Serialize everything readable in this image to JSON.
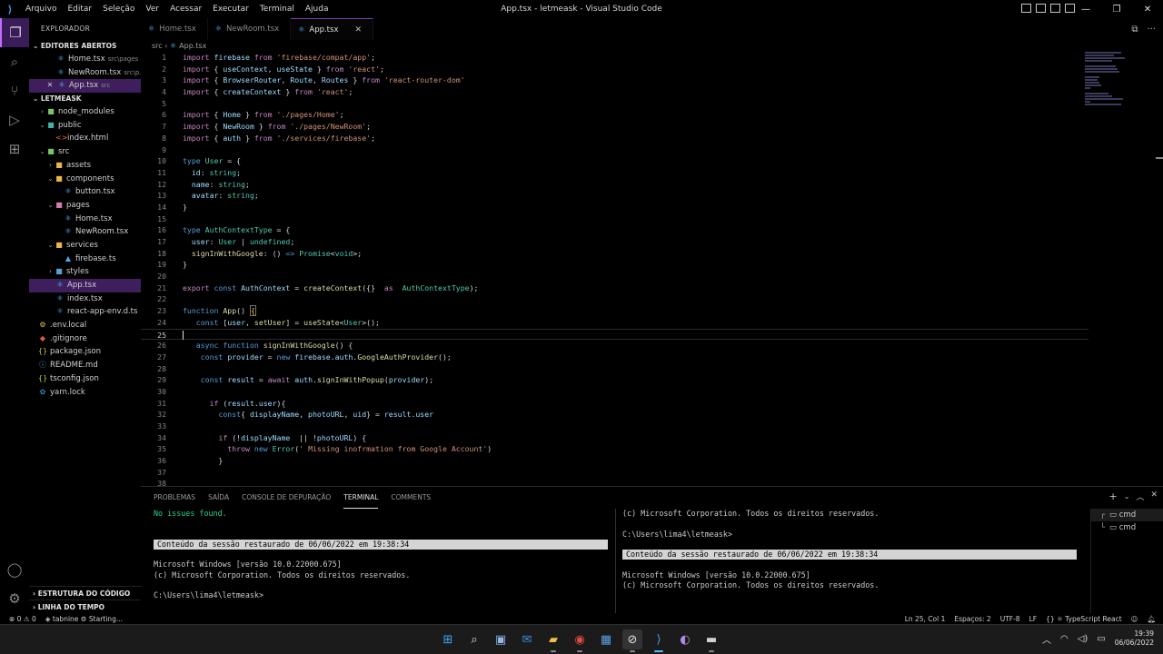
{
  "window": {
    "title": "App.tsx - letmeask - Visual Studio Code",
    "menu": [
      "Arquivo",
      "Editar",
      "Seleção",
      "Ver",
      "Acessar",
      "Executar",
      "Terminal",
      "Ajuda"
    ]
  },
  "activity_bar": {
    "items": [
      "explorer-icon",
      "search-icon",
      "source-control-icon",
      "run-debug-icon",
      "extensions-icon"
    ],
    "bottom": [
      "account-icon",
      "gear-icon"
    ]
  },
  "sidebar": {
    "title": "EXPLORADOR",
    "open_editors_label": "EDITORES ABERTOS",
    "open_editors": [
      {
        "name": "Home.tsx",
        "desc": "src\\pages"
      },
      {
        "name": "NewRoom.tsx",
        "desc": "src\\p..."
      },
      {
        "name": "App.tsx",
        "desc": "src"
      }
    ],
    "project_label": "LETMEASK",
    "tree": [
      {
        "name": "node_modules",
        "type": "folder"
      },
      {
        "name": "public",
        "type": "folder"
      },
      {
        "name": "index.html",
        "type": "html"
      },
      {
        "name": "src",
        "type": "folder"
      },
      {
        "name": "assets",
        "type": "folder"
      },
      {
        "name": "components",
        "type": "folder"
      },
      {
        "name": "button.tsx",
        "type": "tsx"
      },
      {
        "name": "pages",
        "type": "folder"
      },
      {
        "name": "Home.tsx",
        "type": "tsx"
      },
      {
        "name": "NewRoom.tsx",
        "type": "tsx"
      },
      {
        "name": "services",
        "type": "folder"
      },
      {
        "name": "firebase.ts",
        "type": "ts"
      },
      {
        "name": "styles",
        "type": "folder"
      },
      {
        "name": "App.tsx",
        "type": "tsx"
      },
      {
        "name": "index.tsx",
        "type": "tsx"
      },
      {
        "name": "react-app-env.d.ts",
        "type": "ts"
      },
      {
        "name": ".env.local",
        "type": "env"
      },
      {
        "name": ".gitignore",
        "type": "git"
      },
      {
        "name": "package.json",
        "type": "json"
      },
      {
        "name": "README.md",
        "type": "md"
      },
      {
        "name": "tsconfig.json",
        "type": "json"
      },
      {
        "name": "yarn.lock",
        "type": "yarn"
      }
    ],
    "outline_label": "ESTRUTURA DO CÓDIGO",
    "timeline_label": "LINHA DO TEMPO"
  },
  "tabs": [
    {
      "name": "Home.tsx",
      "active": false
    },
    {
      "name": "NewRoom.tsx",
      "active": false
    },
    {
      "name": "App.tsx",
      "active": true
    }
  ],
  "breadcrumb": {
    "folder": "src",
    "sep": "›",
    "file": "App.tsx"
  },
  "code_lines": [
    "1",
    "2",
    "3",
    "4",
    "5",
    "6",
    "7",
    "8",
    "9",
    "10",
    "11",
    "12",
    "13",
    "14",
    "15",
    "16",
    "17",
    "18",
    "19",
    "20",
    "21",
    "22",
    "23",
    "24",
    "25",
    "26",
    "27",
    "28",
    "29",
    "30",
    "31",
    "32",
    "33",
    "34",
    "35",
    "36",
    "37",
    "38"
  ],
  "panel": {
    "tabs": [
      "PROBLEMAS",
      "SAÍDA",
      "CONSOLE DE DEPURAÇÃO",
      "TERMINAL",
      "COMMENTS"
    ],
    "active_tab": "TERMINAL",
    "left_terminal": [
      "No issues found.",
      "",
      "",
      "Conteúdo da sessão restaurado de 06/06/2022 em 19:38:34",
      "",
      "Microsoft Windows [versão 10.0.22000.675]",
      "(c) Microsoft Corporation. Todos os direitos reservados.",
      "",
      "C:\\Users\\lima4\\letmeask>"
    ],
    "right_terminal": [
      "(c) Microsoft Corporation. Todos os direitos reservados.",
      "",
      "C:\\Users\\lima4\\letmeask>",
      "",
      "Conteúdo da sessão restaurado de 06/06/2022 em 19:38:34",
      "",
      "Microsoft Windows [versão 10.0.22000.675]",
      "(c) Microsoft Corporation. Todos os direitos reservados."
    ],
    "terminals": [
      "cmd",
      "cmd"
    ]
  },
  "status": {
    "errors": "0",
    "warnings": "0",
    "tabnine": "tabnine",
    "starting": "Starting...",
    "position": "Ln 25, Col 1",
    "spaces": "Espaços: 2",
    "encoding": "UTF-8",
    "eol": "LF",
    "language": "TypeScript React"
  },
  "taskbar": {
    "time": "19:39",
    "date": "06/06/2022"
  },
  "colors": {
    "accent": "#7a3fb5",
    "active_bg": "#3e1e5c",
    "terminal_green": "#23d18b"
  }
}
